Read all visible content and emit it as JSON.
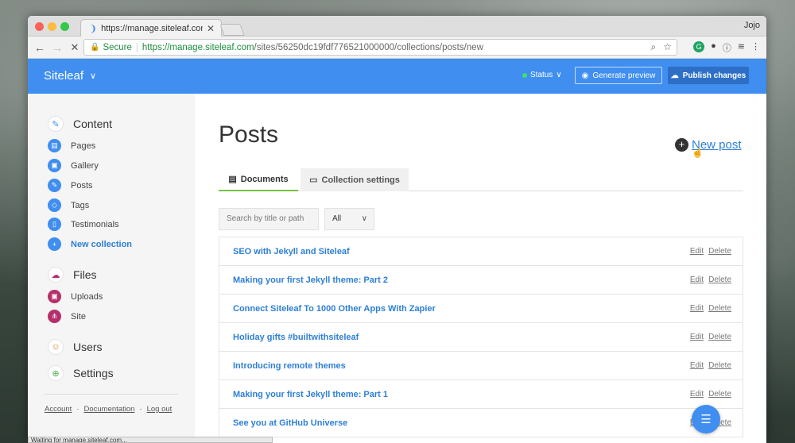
{
  "browser": {
    "tab_title": "https://manage.siteleaf.com/si",
    "profile": "Jojo",
    "secure_label": "Secure",
    "url_host": "https://manage.siteleaf.com",
    "url_path": "/sites/56250dc19fdf776521000000/collections/posts/new",
    "status_text": "Waiting for manage.siteleaf.com..."
  },
  "appbar": {
    "brand": "Siteleaf",
    "status_label": "Status",
    "generate_preview": "Generate preview",
    "publish_changes": "Publish changes"
  },
  "sidebar": {
    "content_label": "Content",
    "items": [
      {
        "label": "Pages"
      },
      {
        "label": "Gallery"
      },
      {
        "label": "Posts"
      },
      {
        "label": "Tags"
      },
      {
        "label": "Testimonials"
      },
      {
        "label": "New collection"
      }
    ],
    "files_label": "Files",
    "file_items": [
      {
        "label": "Uploads"
      },
      {
        "label": "Site"
      }
    ],
    "users_label": "Users",
    "settings_label": "Settings",
    "footer": {
      "account": "Account",
      "documentation": "Documentation",
      "logout": "Log out"
    }
  },
  "main": {
    "title": "Posts",
    "new_post": "New post",
    "tabs": {
      "documents": "Documents",
      "collection_settings": "Collection settings"
    },
    "search_placeholder": "Search by title or path",
    "filter_value": "All",
    "edit_label": "Edit",
    "delete_label": "Delete",
    "posts": [
      {
        "title": "SEO with Jekyll and Siteleaf"
      },
      {
        "title": "Making your first Jekyll theme: Part 2"
      },
      {
        "title": "Connect Siteleaf To 1000 Other Apps With Zapier"
      },
      {
        "title": "Holiday gifts #builtwithsiteleaf"
      },
      {
        "title": "Introducing remote themes"
      },
      {
        "title": "Making your first Jekyll theme: Part 1"
      },
      {
        "title": "See you at GitHub Universe"
      }
    ]
  },
  "colors": {
    "accent": "#3f8ef0",
    "link": "#2d7fd6",
    "tab_active": "#7ac143",
    "status_ok": "#3ee06e"
  }
}
